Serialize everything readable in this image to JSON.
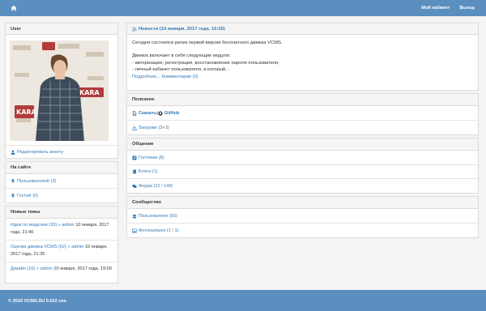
{
  "nav": {
    "cabinet": "Мой кабинет",
    "logout": "Выход"
  },
  "user": {
    "title": "User",
    "edit_link": "Редактировать анкету"
  },
  "onsite": {
    "title": "На сайте",
    "users_label": "Пользователей",
    "users_count": "(3)",
    "guests_label": "Гостей",
    "guests_count": "(0)"
  },
  "new_topics": {
    "title": "Новые темы",
    "items": [
      {
        "topic": "Идеи по модулям (33)",
        "sep": " » ",
        "author": "admin",
        "date": " 10 января, 2017 года, 21:40"
      },
      {
        "topic": "Оценка движка VCMS (52)",
        "sep": " » ",
        "author": "admin",
        "date": " 10 января, 2017 года, 21:35"
      },
      {
        "topic": "Дизайн (10)",
        "sep": " » ",
        "author": "admin",
        "date": " 10 января, 2017 года, 19:09"
      }
    ]
  },
  "news": {
    "title": "Новости (10 января, 2017 года, 10:20)",
    "line1": "Сегодня состоялся релиз первой версии бесплатного движка VCMS.",
    "line2": "Движок включает в себя следующие модули:",
    "line3": "- авторизация, регистрация, восстановление пароля пользователя;",
    "line4": "- личный кабинет пользователя, в который...",
    "more": "Подробнее...",
    "comments": "Комментарии (0)"
  },
  "useful": {
    "title": "Полезное",
    "download": "Скачать",
    "sep": " | ",
    "github": "GitHub",
    "downloads_label": "Загрузки",
    "downloads_count": "(3",
    "downloads_new": " +3",
    "downloads_close": ")"
  },
  "social": {
    "title": "Общение",
    "guestbook": "Гостевая (8)",
    "blogs": "Блоги (1)",
    "forum": "Форум (22 / 149)"
  },
  "community": {
    "title": "Сообщество",
    "users": "Пользователи (50)",
    "gallery": "Фотогалерея (1 / 1)"
  },
  "footer": {
    "text": "© 2016 VCMS.SU 0.022 сек."
  },
  "colors": {
    "navbar": "#5b8fc0",
    "link": "#337ab7",
    "panel_head": "#f5f5f5",
    "badge_red": "#d9534f"
  },
  "photo_labels": [
    "KARA",
    "KARA"
  ]
}
